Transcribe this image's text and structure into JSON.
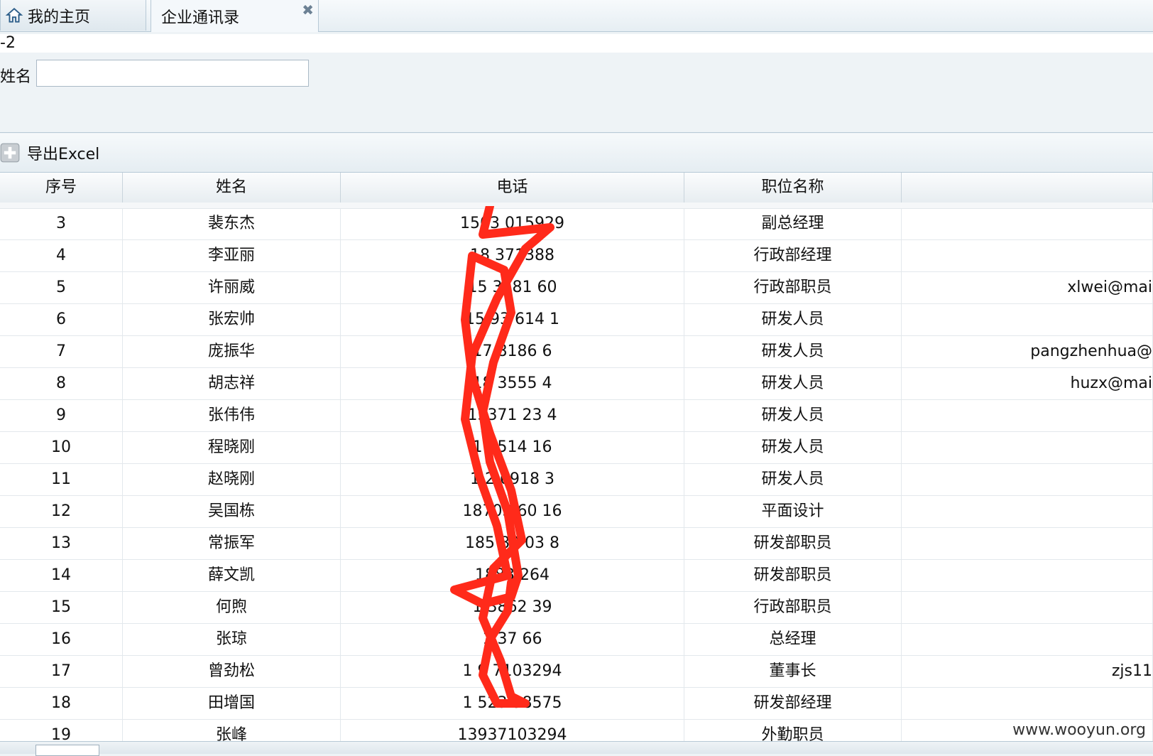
{
  "tabs": [
    {
      "label": "我的主页",
      "icon": "home-icon"
    },
    {
      "label": "企业通讯录",
      "icon": "close-icon",
      "close": "✖"
    }
  ],
  "query": {
    "code_text": "-2",
    "name_label": "姓名",
    "name_value": ""
  },
  "toolbar": {
    "export_label": "导出Excel"
  },
  "grid": {
    "columns": [
      "序号",
      "姓名",
      "电话",
      "职位名称",
      ""
    ],
    "rows": [
      {
        "no": "3",
        "name": "裴东杰",
        "phone": "1503 015929",
        "title": "副总经理",
        "email": ""
      },
      {
        "no": "4",
        "name": "李亚丽",
        "phone": "18 371388",
        "title": "行政部经理",
        "email": ""
      },
      {
        "no": "5",
        "name": "许丽威",
        "phone": "15 3781 60",
        "title": "行政部职员",
        "email": "xlwei@mai"
      },
      {
        "no": "6",
        "name": "张宏帅",
        "phone": "15 93 614 1",
        "title": "研发人员",
        "email": ""
      },
      {
        "no": "7",
        "name": "庞振华",
        "phone": "17 8186 6",
        "title": "研发人员",
        "email": "pangzhenhua@"
      },
      {
        "no": "8",
        "name": "胡志祥",
        "phone": "18 3555 4",
        "title": "研发人员",
        "email": "huzx@mai"
      },
      {
        "no": "9",
        "name": "张伟伟",
        "phone": "15371 23 4",
        "title": "研发人员",
        "email": ""
      },
      {
        "no": "10",
        "name": "程晓刚",
        "phone": "1 0514 16",
        "title": "研发人员",
        "email": ""
      },
      {
        "no": "11",
        "name": "赵晓刚",
        "phone": "1 2 6918 3",
        "title": "研发人员",
        "email": ""
      },
      {
        "no": "12",
        "name": "吴国栋",
        "phone": "18703 60 16",
        "title": "平面设计",
        "email": ""
      },
      {
        "no": "13",
        "name": "常振军",
        "phone": "185 80 03 8",
        "title": "研发部职员",
        "email": ""
      },
      {
        "no": "14",
        "name": "薛文凯",
        "phone": "1883 264",
        "title": "研发部职员",
        "email": ""
      },
      {
        "no": "15",
        "name": "何煦",
        "phone": "1 3862 39",
        "title": "行政部职员",
        "email": ""
      },
      {
        "no": "16",
        "name": "张琼",
        "phone": "1 37 66",
        "title": "总经理",
        "email": ""
      },
      {
        "no": "17",
        "name": "曾劲松",
        "phone": "1 9 7103294",
        "title": "董事长",
        "email": "zjs11"
      },
      {
        "no": "18",
        "name": "田增国",
        "phone": "1 523 98575",
        "title": "研发部经理",
        "email": ""
      },
      {
        "no": "19",
        "name": "张峰",
        "phone": "13937103294",
        "title": "外勤职员",
        "email": ""
      }
    ]
  },
  "watermark": "www.wooyun.org",
  "colors": {
    "scribble": "#ff2a1a",
    "border": "#b7c9d6"
  }
}
